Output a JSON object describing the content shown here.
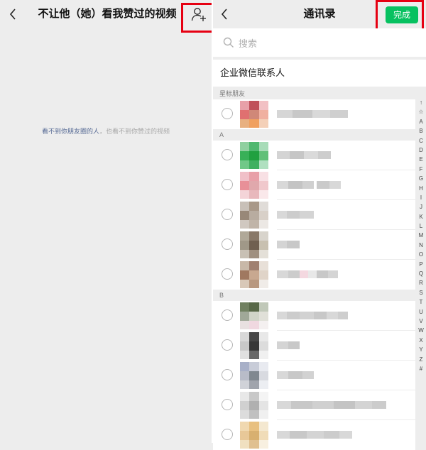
{
  "left": {
    "title": "不让他（她）看我赞过的视频",
    "empty_prefix": "看不到你朋友圈的人",
    "empty_suffix": "，也看不到你赞过的视频"
  },
  "right": {
    "title": "通讯录",
    "done_label": "完成",
    "search_placeholder": "搜索",
    "enterprise_label": "企业微信联系人",
    "sections": {
      "starred": "星标朋友",
      "a": "A",
      "b": "B"
    },
    "index_letters": [
      "↑",
      "☆",
      "A",
      "B",
      "C",
      "D",
      "E",
      "F",
      "G",
      "H",
      "I",
      "J",
      "K",
      "L",
      "M",
      "N",
      "O",
      "P",
      "Q",
      "R",
      "S",
      "T",
      "U",
      "V",
      "W",
      "X",
      "Y",
      "Z",
      "#"
    ]
  },
  "colors": {
    "accent": "#07c160",
    "highlight": "#e60012",
    "link": "#576b95",
    "background": "#ededed"
  },
  "icons": {
    "back": "chevron-left-icon",
    "add_user": "add-user-icon",
    "search": "search-icon"
  }
}
